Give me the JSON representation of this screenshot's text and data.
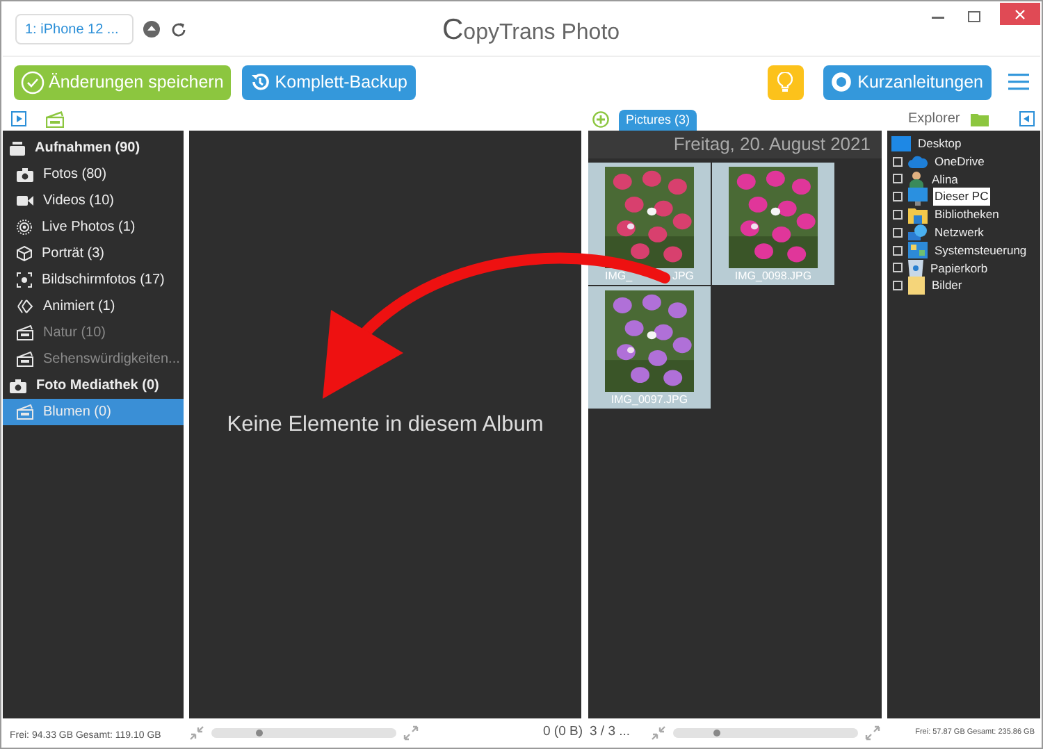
{
  "window": {
    "title_prefix": "C",
    "title_rest": "opyTrans Photo"
  },
  "device": {
    "label": "1: iPhone 12 ..."
  },
  "toolbar": {
    "save": "Änderungen speichern",
    "backup": "Komplett-Backup",
    "guides": "Kurzanleitungen"
  },
  "albums": [
    {
      "label": "Aufnahmen (90)",
      "kind": "header",
      "disabled": false,
      "selected": false
    },
    {
      "label": "Fotos (80)",
      "kind": "item",
      "disabled": false,
      "selected": false
    },
    {
      "label": "Videos (10)",
      "kind": "item",
      "disabled": false,
      "selected": false
    },
    {
      "label": "Live Photos (1)",
      "kind": "item",
      "disabled": false,
      "selected": false
    },
    {
      "label": "Porträt (3)",
      "kind": "item",
      "disabled": false,
      "selected": false
    },
    {
      "label": "Bildschirmfotos (17)",
      "kind": "item",
      "disabled": false,
      "selected": false
    },
    {
      "label": "Animiert (1)",
      "kind": "item",
      "disabled": false,
      "selected": false
    },
    {
      "label": "Natur (10)",
      "kind": "item",
      "disabled": true,
      "selected": false
    },
    {
      "label": "Sehenswürdigkeiten...",
      "kind": "item",
      "disabled": true,
      "selected": false
    },
    {
      "label": "Foto Mediathek (0)",
      "kind": "header",
      "disabled": false,
      "selected": false
    },
    {
      "label": "Blumen (0)",
      "kind": "item",
      "disabled": false,
      "selected": true
    }
  ],
  "album_view": {
    "count": "0 (0 B)",
    "empty_message": "Keine Elemente in diesem Album",
    "zoom": {
      "level": 0.25
    }
  },
  "pictures": {
    "tab": "Pictures (3)",
    "date": "Freitag, 20. August 2021",
    "pager": "3 / 3 ...",
    "zoom": {
      "level": 0.23
    },
    "photos": [
      {
        "caption_start": "IMG_",
        "caption_end": "JPG"
      },
      {
        "caption": "IMG_0098.JPG"
      },
      {
        "caption": "IMG_0097.JPG"
      }
    ]
  },
  "explorer": {
    "title": "Explorer",
    "tree": {
      "label": "Desktop",
      "selected": false,
      "children": [
        {
          "label": "OneDrive",
          "selected": false
        },
        {
          "label": "Alina",
          "selected": false
        },
        {
          "label": "Dieser PC",
          "selected": true
        },
        {
          "label": "Bibliotheken",
          "selected": false
        },
        {
          "label": "Netzwerk",
          "selected": false
        },
        {
          "label": "Systemsteuerung",
          "selected": false
        },
        {
          "label": "Papierkorb",
          "selected": false
        },
        {
          "label": "Bilder",
          "selected": false
        }
      ]
    }
  },
  "status": {
    "left": "Frei: 94.33 GB Gesamt: 119.10 GB",
    "right": "Frei: 57.87 GB Gesamt: 235.86 GB"
  }
}
